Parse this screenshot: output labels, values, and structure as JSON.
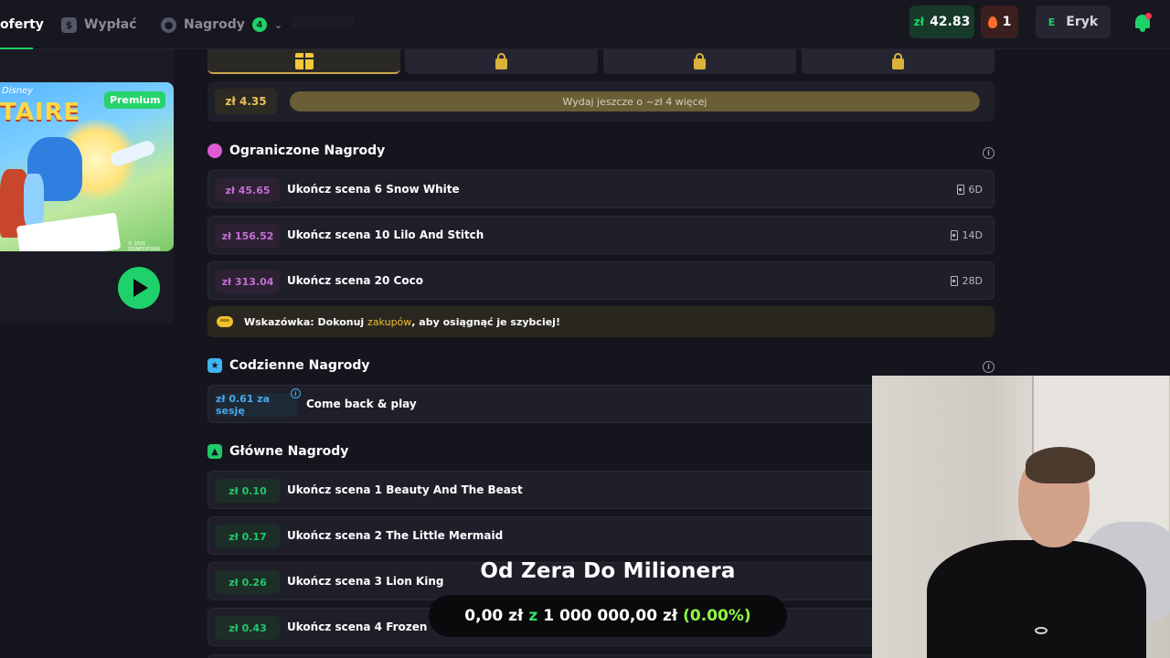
{
  "nav": {
    "offers": "oferty",
    "withdraw": "Wypłać",
    "rewards": "Nagrody",
    "rewards_badge": "4"
  },
  "header": {
    "currency": "zł",
    "balance": "42.83",
    "streak": "1",
    "user_initial": "E",
    "user_name": "Eryk"
  },
  "game": {
    "brand": "Disney",
    "title": "TAIRE",
    "copyright": "© 2021 DISNEY/PIXAR",
    "badge": "Premium"
  },
  "progress": {
    "amount": "zł 4.35",
    "text": "Wydaj jeszcze o ~zł 4 więcej",
    "fill_fraction": 1.0
  },
  "limited": {
    "title": "Ograniczone Nagrody",
    "rows": [
      {
        "amount": "zł 45.65",
        "label": "Ukończ scena 6 Snow White",
        "time": "6D"
      },
      {
        "amount": "zł 156.52",
        "label": "Ukończ scena 10 Lilo And Stitch",
        "time": "14D"
      },
      {
        "amount": "zł 313.04",
        "label": "Ukończ scena 20 Coco",
        "time": "28D"
      }
    ]
  },
  "tip": {
    "prefix": "Wskazówka: Dokonuj ",
    "link": "zakupów",
    "suffix": ", aby osiągnąć je szybciej!"
  },
  "daily": {
    "title": "Codzienne Nagrody",
    "amount": "zł 0.61 za sesję",
    "label": "Come back & play"
  },
  "main_rewards": {
    "title": "Główne Nagrody",
    "rows": [
      {
        "amount": "zł 0.10",
        "label": "Ukończ scena 1 Beauty And The Beast"
      },
      {
        "amount": "zł 0.17",
        "label": "Ukończ scena 2 The Little Mermaid"
      },
      {
        "amount": "zł 0.26",
        "label": "Ukończ scena 3 Lion King"
      },
      {
        "amount": "zł 0.43",
        "label": "Ukończ scena 4 Frozen"
      }
    ]
  },
  "overlay": {
    "title": "Od Zera Do Milionera",
    "current": "0,00 zł",
    "sep": "z",
    "goal": "1 000 000,00 zł",
    "percent": "(0.00%)"
  },
  "colors": {
    "accent_green": "#1fd16a",
    "gold": "#e8c25a",
    "pink": "#c46ed6",
    "blue": "#47a8f0"
  },
  "icons": [
    "wallet-icon",
    "rewards-icon",
    "chevron-down-icon",
    "flame-icon",
    "bell-icon",
    "gift-icon",
    "lock-icon",
    "stopwatch-icon",
    "calendar-icon",
    "chart-icon",
    "hourglass-icon",
    "info-icon",
    "coins-icon",
    "play-icon"
  ]
}
